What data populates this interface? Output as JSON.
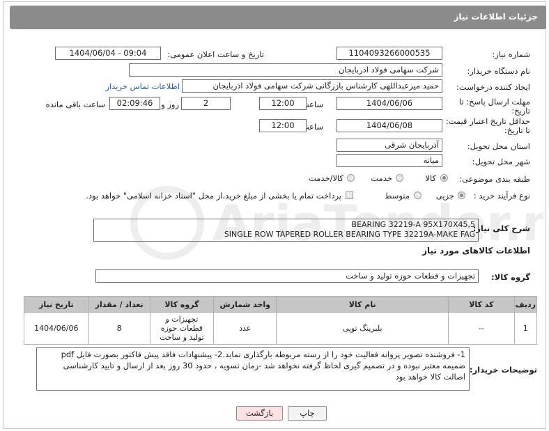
{
  "header": {
    "title": "جزئیات اطلاعات نیاز"
  },
  "fields": {
    "need_number_label": "شماره نیاز:",
    "need_number": "1104093266000535",
    "announce_label": "تاریخ و ساعت اعلان عمومی:",
    "announce_value": "1404/06/04 - 09:04",
    "buyer_org_label": "نام دستگاه خریدار:",
    "buyer_org": "شرکت سهامی فولاد اذربایجان",
    "creator_label": "ایجاد کننده درخواست:",
    "creator": "حمید میرعبداللهی کارشناس بازرگانی شرکت سهامی فولاد اذربایجان",
    "contact_link": "اطلاعات تماس خریدار",
    "reply_deadline_label_1": "مهلت ارسال پاسخ: تا",
    "reply_deadline_label_2": "تاریخ:",
    "reply_date": "1404/06/06",
    "hour_label": "ساعت",
    "reply_time": "12:00",
    "days_value": "2",
    "days_label": "روز و",
    "remaining_value": "02:09:46",
    "remaining_label": "ساعت باقی مانده",
    "price_deadline_label_1": "حداقل تاریخ اعتبار قیمت:",
    "price_deadline_label_2": "تا تاریخ:",
    "price_date": "1404/06/08",
    "price_hour_label": "ساعت",
    "price_time": "12:00",
    "province_label": "استان محل تحویل:",
    "province": "آذربایجان شرقی",
    "city_label": "شهر محل تحویل:",
    "city": "میانه",
    "category_label": "طبقه بندی موضوعی:",
    "category_options": [
      "کالا",
      "خدمت",
      "کالا/خدمت"
    ],
    "category_selected": "کالا",
    "process_label": "نوع فرآیند خرید :",
    "process_options": [
      "جزیی",
      "متوسط"
    ],
    "process_selected": "جزیی",
    "payment_note": "پرداخت تمام یا بخشی از مبلغ خرید،از محل \"اسناد خزانه اسلامی\" خواهد بود."
  },
  "description": {
    "label": "شرح کلی نیاز:",
    "line1": "BEARING 32219-A 95X170X45,5",
    "line2": "SINGLE ROW TAPERED ROLLER BEARING TYPE 32219A-MAKE FAG"
  },
  "goods_section": {
    "title": "اطلاعات کالاهای مورد نیاز",
    "group_label": "گروه کالا:",
    "group_value": "تجهیزات و قطعات حوزه تولید و ساخت"
  },
  "table": {
    "headers": [
      "ردیف",
      "کد کالا",
      "نام کالا",
      "واحد شمارش",
      "گروه کالا",
      "تعداد / مقدار",
      "تاریخ نیاز"
    ],
    "rows": [
      [
        "1",
        "--",
        "بلبرینگ توپی",
        "عدد",
        "تجهیزات و قطعات حوزه تولید و ساخت",
        "8",
        "1404/06/06"
      ]
    ]
  },
  "buyer_notes": {
    "label": "توضیحات خریدار:",
    "text": "1- فروشنده تصویر پروانه فعالیت خود را از رسته مربوطه بارگذاری نماید.2- پیشنهادات فاقد پیش فاکتور بصورت فایل pdf ضمیمه معتبر نبوده و در تصمیم گیری لحاظ گرفته نخواهد شد -زمان تسویه ، حدود 30 روز بعد از ارسال و تایید کارشناسی اصالت کالا خواهد بود"
  },
  "buttons": {
    "print": "چاپ",
    "back": "بازگشت"
  },
  "colors": {
    "header_bg": "#8c8c8c",
    "table_header_bg": "#c6c6c6",
    "back_button_bg": "#fbe1e1",
    "link": "#1a5fb4"
  },
  "watermark": {
    "text": "AriaTender.neT"
  }
}
